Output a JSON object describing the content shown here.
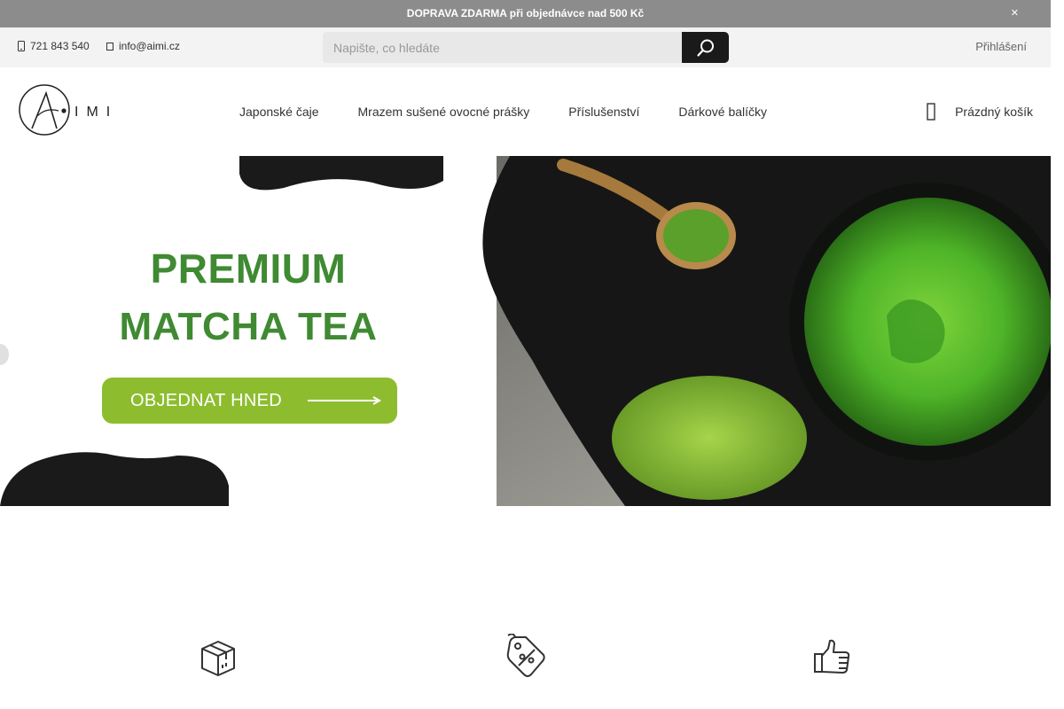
{
  "topbar": {
    "message": "DOPRAVA ZDARMA při objednávce nad 500 Kč",
    "close_icon": "close-icon"
  },
  "contact": {
    "phone": "721 843 540",
    "email": "info@aimi.cz"
  },
  "search": {
    "placeholder": "Napište, co hledáte",
    "value": ""
  },
  "account": {
    "login_label": "Přihlášení"
  },
  "logo": {
    "text": "AIMI"
  },
  "nav": {
    "items": [
      {
        "label": "Japonské čaje"
      },
      {
        "label": "Mrazem sušené ovocné prášky"
      },
      {
        "label": "Příslušenství"
      },
      {
        "label": "Dárkové balíčky"
      }
    ]
  },
  "cart": {
    "label": "Prázdný košík"
  },
  "hero": {
    "title_line1": "PREMIUM",
    "title_line2": "MATCHA TEA",
    "cta_label": "OBJEDNAT HNED",
    "colors": {
      "title": "#3f8a32",
      "cta": "#8dbd2f"
    }
  },
  "features": [
    {
      "icon": "package-icon"
    },
    {
      "icon": "price-tag-icon"
    },
    {
      "icon": "thumbs-up-icon"
    }
  ]
}
